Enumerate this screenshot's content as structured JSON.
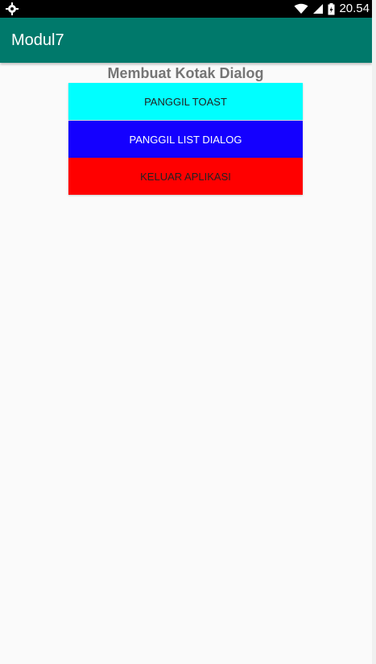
{
  "status_bar": {
    "time": "20.54",
    "left_icon": "android-debug-icon",
    "icons": [
      "wifi-icon",
      "signal-icon",
      "battery-icon"
    ]
  },
  "app_bar": {
    "title": "Modul7",
    "color": "#00796b"
  },
  "main": {
    "heading": "Membuat Kotak Dialog",
    "buttons": [
      {
        "label": "PANGGIL TOAST",
        "color": "#00ffff"
      },
      {
        "label": "PANGGIL LIST DIALOG",
        "color": "#1400ff"
      },
      {
        "label": "KELUAR APLIKASI",
        "color": "#ff0000"
      }
    ]
  }
}
